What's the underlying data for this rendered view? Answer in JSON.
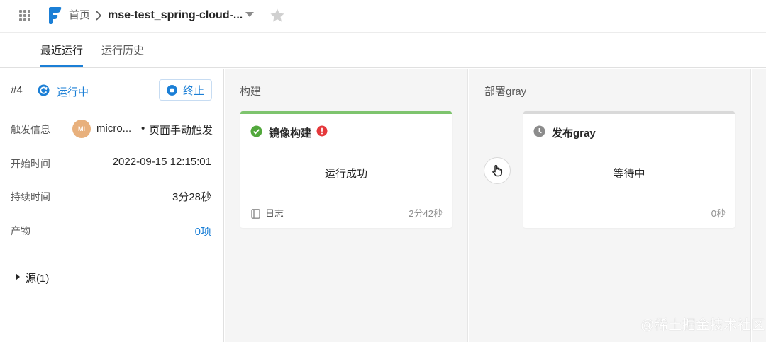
{
  "header": {
    "breadcrumb_home": "首页",
    "pipeline_name": "mse-test_spring-cloud-...",
    "icons": [
      "apps-grid-icon",
      "logo-icon",
      "chevron-right-icon",
      "caret-down-icon",
      "star-icon"
    ]
  },
  "tabs": [
    {
      "label": "最近运行",
      "active": true
    },
    {
      "label": "运行历史",
      "active": false
    }
  ],
  "run": {
    "number": "#4",
    "status": "运行中",
    "stop_label": "终止",
    "trigger_label": "触发信息",
    "trigger_user": "micro...",
    "trigger_dot": "•",
    "trigger_type": "页面手动触发",
    "avatar_text": "MI",
    "start_label": "开始时间",
    "start_value": "2022-09-15 12:15:01",
    "duration_label": "持续时间",
    "duration_value": "3分28秒",
    "artifact_label": "产物",
    "artifact_value": "0项",
    "source_label": "源(1)"
  },
  "stages": [
    {
      "title": "构建",
      "job": {
        "name": "镜像构建",
        "status_text": "运行成功",
        "log_label": "日志",
        "duration": "2分42秒",
        "state": "success",
        "bar_color": "#7ec46e"
      }
    },
    {
      "title": "部署gray",
      "job": {
        "name": "发布gray",
        "status_text": "等待中",
        "duration": "0秒",
        "state": "waiting",
        "bar_color": "#d9d9d9"
      }
    }
  ],
  "colors": {
    "accent": "#1b7fd6",
    "success": "#52a83c",
    "error": "#e5383b",
    "waiting": "#8c8c8c"
  },
  "watermark": "@稀土掘金技术社区"
}
